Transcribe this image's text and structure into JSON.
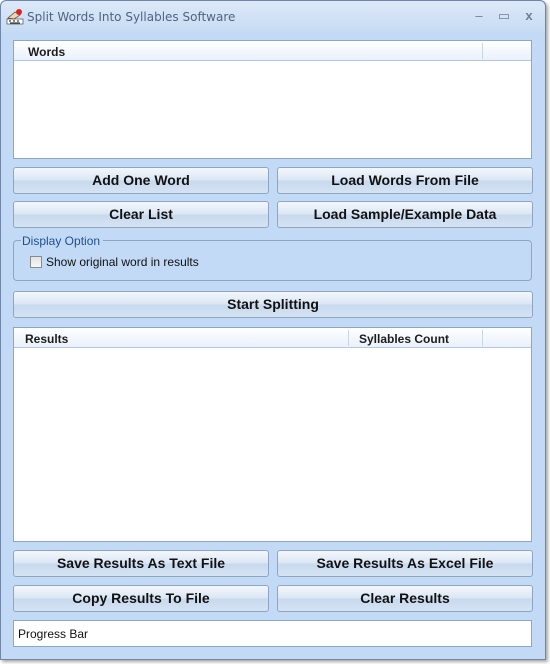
{
  "window": {
    "title": "Split Words Into Syllables Software",
    "icon": "app-icon",
    "controls": {
      "minimize": "–",
      "maximize": "▭",
      "close": "x"
    }
  },
  "words_list": {
    "columns": [
      "Words"
    ],
    "rows": []
  },
  "buttons": {
    "add_one_word": "Add One Word",
    "load_words_from_file": "Load Words From File",
    "clear_list": "Clear List",
    "load_sample": "Load Sample/Example Data",
    "start_splitting": "Start Splitting",
    "save_text": "Save Results As Text File",
    "save_excel": "Save Results As Excel File",
    "copy_results": "Copy Results To File",
    "clear_results": "Clear Results"
  },
  "display_option": {
    "legend": "Display Option",
    "show_original_label": "Show original word in results",
    "show_original_checked": false
  },
  "results_list": {
    "columns": [
      "Results",
      "Syllables Count"
    ],
    "rows": []
  },
  "progress": {
    "label": "Progress Bar",
    "value": 0
  }
}
